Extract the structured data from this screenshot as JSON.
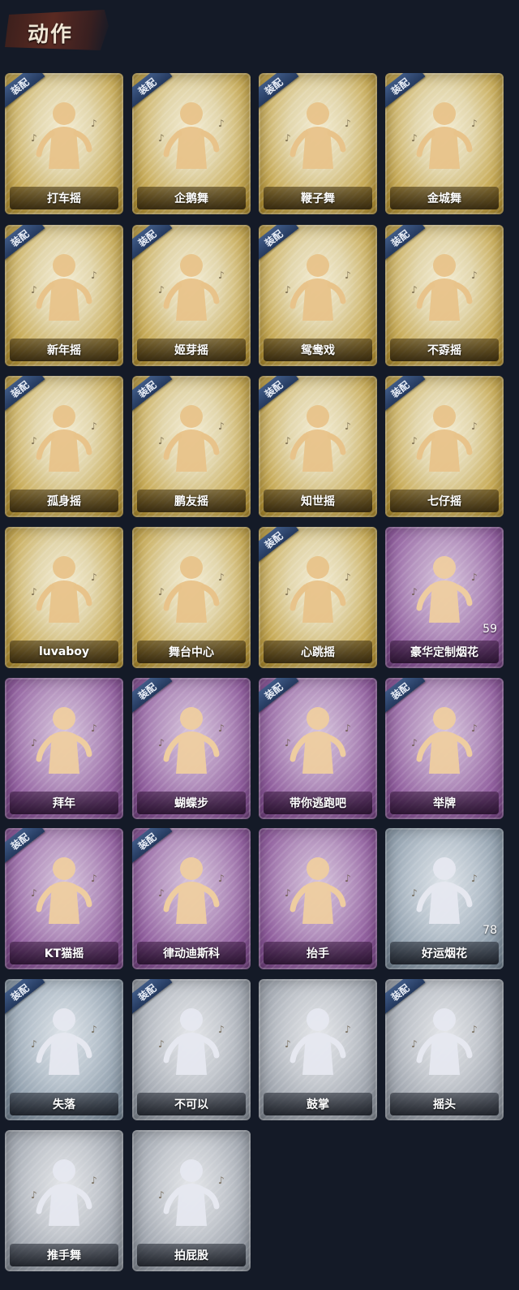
{
  "header": {
    "title": "动作"
  },
  "badge_label": "装配",
  "cards": [
    {
      "label": "打车摇",
      "tier": "gold",
      "equipped": true,
      "count": ""
    },
    {
      "label": "企鹅舞",
      "tier": "gold",
      "equipped": true,
      "count": ""
    },
    {
      "label": "鞭子舞",
      "tier": "gold",
      "equipped": true,
      "count": ""
    },
    {
      "label": "金城舞",
      "tier": "gold",
      "equipped": true,
      "count": ""
    },
    {
      "label": "新年摇",
      "tier": "gold",
      "equipped": true,
      "count": ""
    },
    {
      "label": "姬芽摇",
      "tier": "gold",
      "equipped": true,
      "count": ""
    },
    {
      "label": "鸳鸯戏",
      "tier": "gold",
      "equipped": true,
      "count": ""
    },
    {
      "label": "不孬摇",
      "tier": "gold",
      "equipped": true,
      "count": ""
    },
    {
      "label": "孤身摇",
      "tier": "gold",
      "equipped": true,
      "count": ""
    },
    {
      "label": "鹏友摇",
      "tier": "gold",
      "equipped": true,
      "count": ""
    },
    {
      "label": "知世摇",
      "tier": "gold",
      "equipped": true,
      "count": ""
    },
    {
      "label": "七仔摇",
      "tier": "gold",
      "equipped": true,
      "count": ""
    },
    {
      "label": "luvaboy",
      "tier": "gold",
      "equipped": false,
      "count": ""
    },
    {
      "label": "舞台中心",
      "tier": "gold",
      "equipped": false,
      "count": ""
    },
    {
      "label": "心跳摇",
      "tier": "gold",
      "equipped": true,
      "count": ""
    },
    {
      "label": "豪华定制烟花",
      "tier": "purple",
      "equipped": false,
      "count": "59"
    },
    {
      "label": "拜年",
      "tier": "purple",
      "equipped": false,
      "count": ""
    },
    {
      "label": "蝴蝶步",
      "tier": "purple",
      "equipped": true,
      "count": ""
    },
    {
      "label": "带你逃跑吧",
      "tier": "purple",
      "equipped": true,
      "count": ""
    },
    {
      "label": "举牌",
      "tier": "purple",
      "equipped": true,
      "count": ""
    },
    {
      "label": "KT猫摇",
      "tier": "purple",
      "equipped": true,
      "count": ""
    },
    {
      "label": "律动迪斯科",
      "tier": "purple",
      "equipped": true,
      "count": ""
    },
    {
      "label": "抬手",
      "tier": "purple",
      "equipped": false,
      "count": ""
    },
    {
      "label": "好运烟花",
      "tier": "bluesilver",
      "equipped": false,
      "count": "78"
    },
    {
      "label": "失落",
      "tier": "bluesilver",
      "equipped": true,
      "count": ""
    },
    {
      "label": "不可以",
      "tier": "silver",
      "equipped": true,
      "count": ""
    },
    {
      "label": "鼓掌",
      "tier": "silver",
      "equipped": false,
      "count": ""
    },
    {
      "label": "摇头",
      "tier": "silver",
      "equipped": true,
      "count": ""
    },
    {
      "label": "推手舞",
      "tier": "silver",
      "equipped": false,
      "count": ""
    },
    {
      "label": "拍屁股",
      "tier": "silver",
      "equipped": false,
      "count": ""
    }
  ],
  "colors": {
    "background": "#141a27",
    "gold": "#c9ad5b",
    "purple": "#8e5b9c",
    "silver": "#9ea4ad",
    "badge": "#2f4670",
    "figure_gold": "#e8c38a",
    "figure_purple": "#eecda0",
    "figure_silver": "#e6e8f0"
  }
}
